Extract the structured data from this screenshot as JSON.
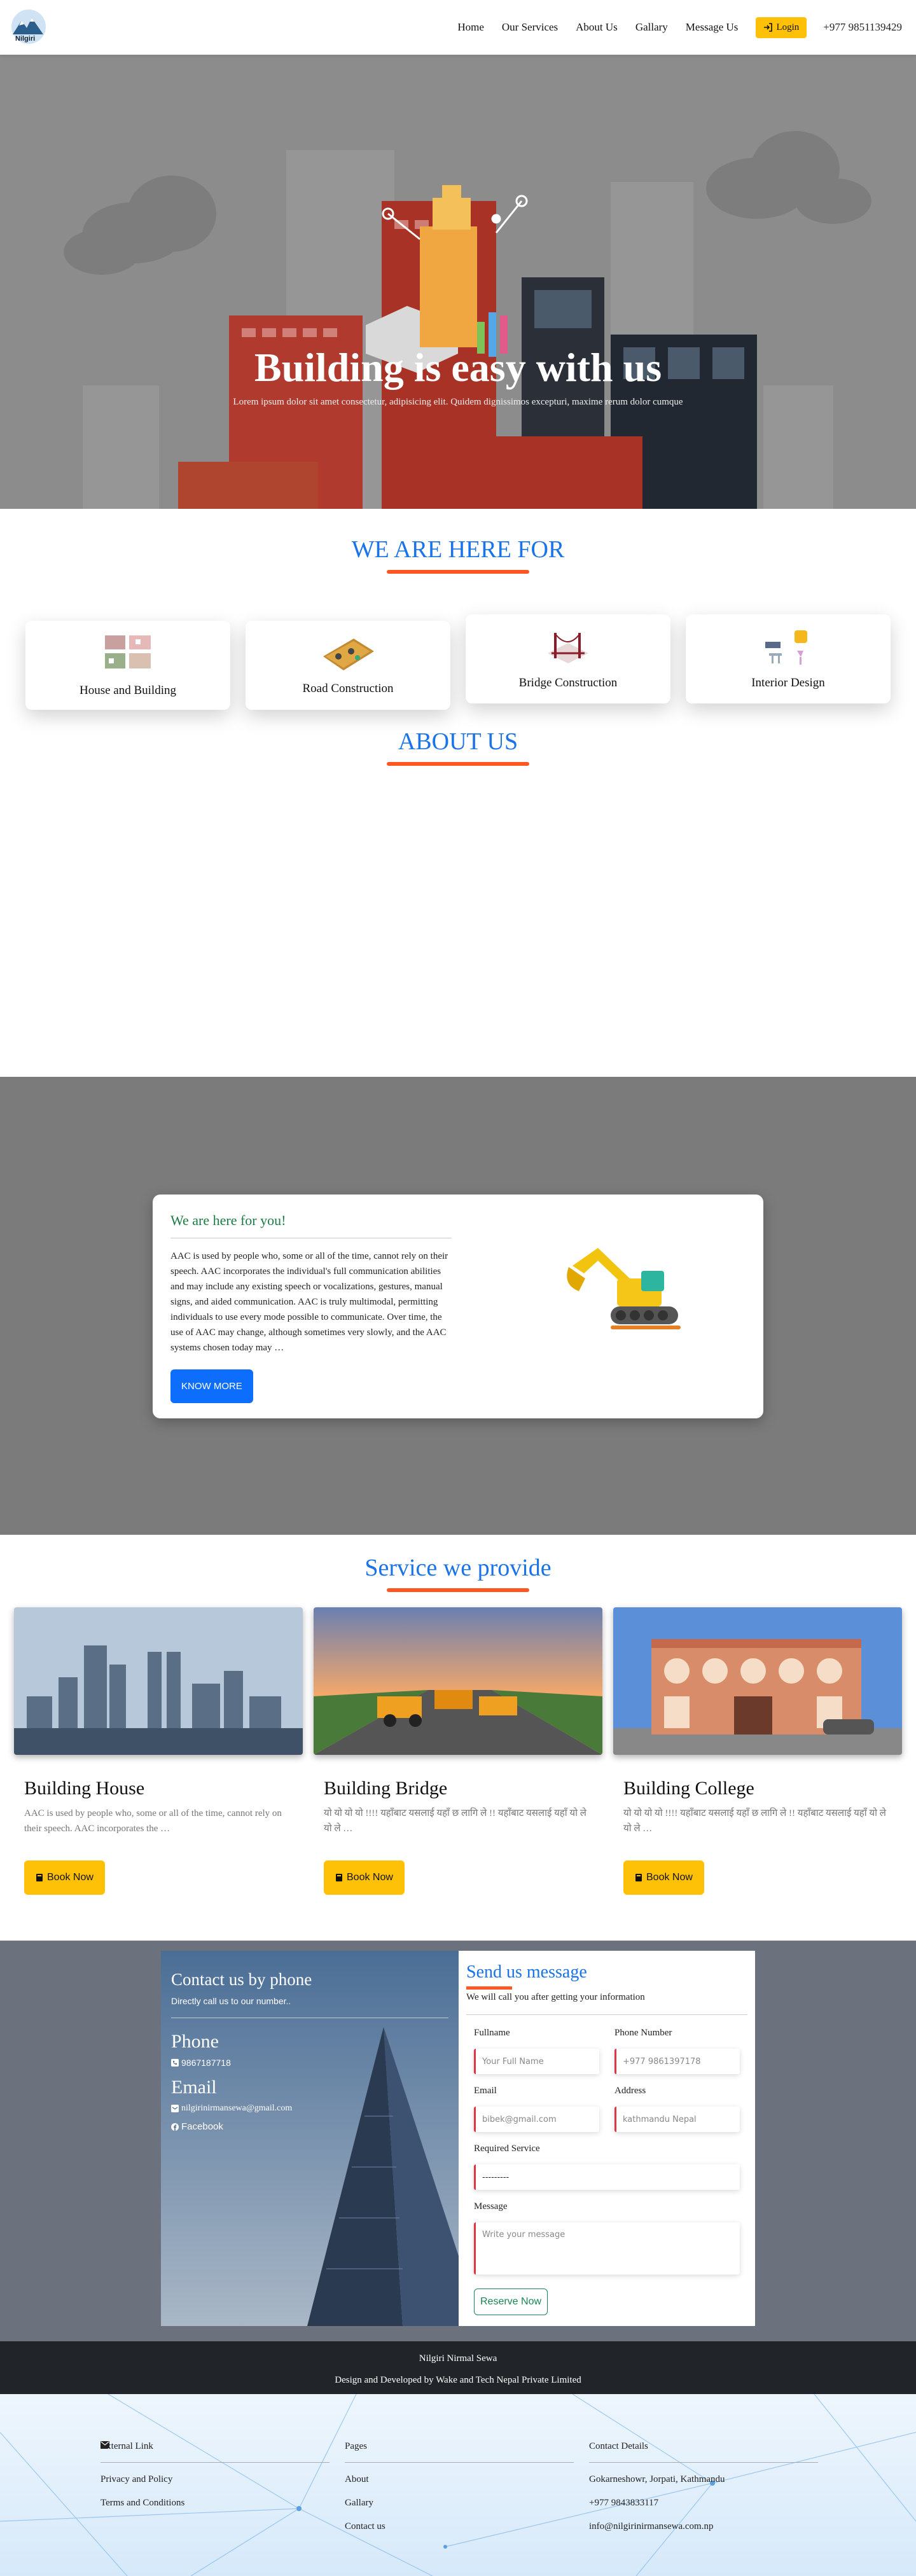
{
  "nav": {
    "logo_text": "Nilgiri",
    "items": [
      "Home",
      "Our Services",
      "About Us",
      "Gallary",
      "Message Us"
    ],
    "login_label": "Login",
    "phone": "+977 9851139429"
  },
  "hero": {
    "title": "Building is easy with us",
    "subtitle": "Lorem ipsum dolor sit amet consectetur, adipisicing elit. Quidem dignissimos excepturi, maxime rerum dolor cumque"
  },
  "here_for": {
    "title": "WE ARE HERE FOR",
    "cards": [
      "House and Building",
      "Road Construction",
      "Bridge Construction",
      "Interior Design"
    ]
  },
  "about": {
    "title": "ABOUT US",
    "heading": "We are here for you!",
    "text": "AAC is used by people who, some or all of the time, cannot rely on their speech. AAC incorporates the individual's full communication abilities and may include any existing speech or vocalizations, gestures, manual signs, and aided communication. AAC is truly multimodal, permitting individuals to use every mode possible to communicate. Over time, the use of AAC may change, although sometimes very slowly, and the AAC systems chosen today may …",
    "button": "KNOW MORE"
  },
  "services": {
    "title": "Service we provide",
    "items": [
      {
        "title": "Building House",
        "desc": "AAC is used by people who, some or all of the time, cannot rely on their speech. AAC incorporates the …",
        "button": "Book Now"
      },
      {
        "title": "Building Bridge",
        "desc": "यो यो यो यो !!!! यहाँबाट यसलाई यहाँ छ लागि ले !! यहाँबाट यसलाई यहाँ यो ले यो ले …",
        "button": "Book Now"
      },
      {
        "title": "Building College",
        "desc": "यो यो यो यो !!!! यहाँबाट यसलाई यहाँ छ लागि ले !! यहाँबाट यसलाई यहाँ यो ले यो ले …",
        "button": "Book Now"
      }
    ]
  },
  "contact": {
    "left_title": "Contact us by phone",
    "left_sub": "Directly call us to our number..",
    "phone_heading": "Phone",
    "phone": "9867187718",
    "email_heading": "Email",
    "email": "nilgirinirmansewa@gmail.com",
    "facebook": "Facebook",
    "form_title": "Send us message",
    "form_sub": "We will call you after getting your information",
    "labels": {
      "fullname": "Fullname",
      "phone": "Phone Number",
      "email": "Email",
      "address": "Address",
      "service": "Required Service",
      "message": "Message"
    },
    "placeholders": {
      "fullname": "Your Full Name",
      "phone": "+977 9861397178",
      "email": "bibek@gmail.com",
      "address": "kathmandu Nepal",
      "service": "---------",
      "message": "Write your message"
    },
    "submit": "Reserve Now"
  },
  "footer": {
    "company": "Nilgiri Nirmal Sewa",
    "credit": "Design and Developed by Wake and Tech Nepal Private Limited",
    "cols": [
      {
        "title": "External Link",
        "items": [
          "Privacy and Policy",
          "Terms and Conditions"
        ]
      },
      {
        "title": "Pages",
        "items": [
          "About",
          "Gallary",
          "Contact us"
        ]
      },
      {
        "title": "Contact Details",
        "items": [
          "Gokarneshowr, Jorpati, Kathmandu",
          "+977 9843833117",
          "info@nilgirinirmansewa.com.np"
        ]
      }
    ]
  }
}
